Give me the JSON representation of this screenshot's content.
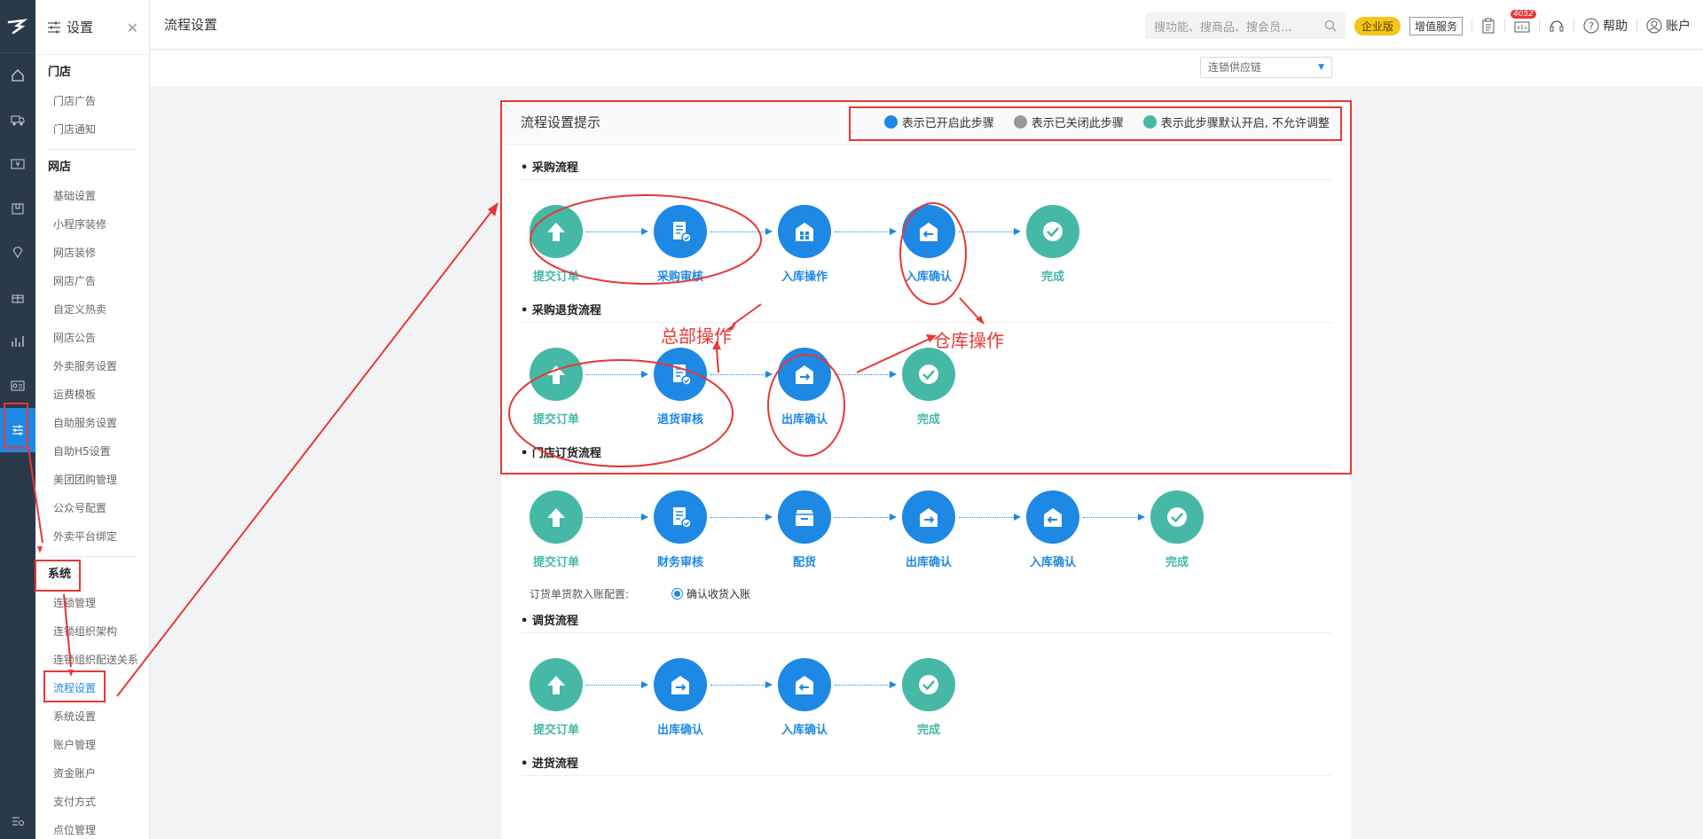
{
  "page_title": "流程设置",
  "search": {
    "placeholder": "搜功能、搜商品、搜会员..."
  },
  "topbar": {
    "badge": "企业版",
    "service": "增值服务",
    "message_count": "4052",
    "help": "帮助",
    "account": "账户"
  },
  "chain_select": {
    "value": "连锁供应链"
  },
  "menu": {
    "title": "设置",
    "groups": [
      {
        "title": "门店",
        "items": [
          "门店广告",
          "门店通知"
        ]
      },
      {
        "title": "网店",
        "items": [
          "基础设置",
          "小程序装修",
          "网店装修",
          "网店广告",
          "自定义热卖",
          "网店公告",
          "外卖服务设置",
          "运费模板",
          "自助服务设置",
          "自助H5设置",
          "美团团购管理",
          "公众号配置",
          "外卖平台绑定"
        ]
      },
      {
        "title": "系统",
        "items": [
          "连锁管理",
          "连锁组织架构",
          "连锁组织配送关系",
          "流程设置",
          "系统设置",
          "账户管理",
          "资金账户",
          "支付方式",
          "点位管理"
        ]
      }
    ],
    "active_item": "流程设置"
  },
  "tips": {
    "title": "流程设置提示",
    "legend": [
      {
        "label": "表示已开启此步骤",
        "color": "#1e88e5"
      },
      {
        "label": "表示已关闭此步骤",
        "color": "#999999"
      },
      {
        "label": "表示此步骤默认开启, 不允许调整",
        "color": "#45b8a6"
      }
    ]
  },
  "flows": [
    {
      "title": "• 采购流程",
      "steps": [
        {
          "label": "提交订单",
          "color": "teal",
          "icon": "upload-icon"
        },
        {
          "label": "采购审核",
          "color": "blue",
          "icon": "doc-check-icon"
        },
        {
          "label": "入库操作",
          "color": "blue",
          "icon": "warehouse-icon"
        },
        {
          "label": "入库确认",
          "color": "blue",
          "icon": "inbound-icon"
        },
        {
          "label": "完成",
          "color": "teal",
          "icon": "check-icon"
        }
      ]
    },
    {
      "title": "• 采购退货流程",
      "steps": [
        {
          "label": "提交订单",
          "color": "teal",
          "icon": "upload-icon"
        },
        {
          "label": "退货审核",
          "color": "blue",
          "icon": "doc-check-icon"
        },
        {
          "label": "出库确认",
          "color": "blue",
          "icon": "outbound-icon"
        },
        {
          "label": "完成",
          "color": "teal",
          "icon": "check-icon"
        }
      ]
    },
    {
      "title": "• 门店订货流程",
      "steps": [
        {
          "label": "提交订单",
          "color": "teal",
          "icon": "upload-icon"
        },
        {
          "label": "财务审核",
          "color": "blue",
          "icon": "doc-check-icon"
        },
        {
          "label": "配货",
          "color": "blue",
          "icon": "box-icon"
        },
        {
          "label": "出库确认",
          "color": "blue",
          "icon": "outbound-icon"
        },
        {
          "label": "入库确认",
          "color": "blue",
          "icon": "inbound-icon"
        },
        {
          "label": "完成",
          "color": "teal",
          "icon": "check-icon"
        }
      ],
      "config": {
        "label": "订货单货款入账配置:",
        "option": "确认收货入账"
      }
    },
    {
      "title": "• 调货流程",
      "steps": [
        {
          "label": "提交订单",
          "color": "teal",
          "icon": "upload-icon"
        },
        {
          "label": "出库确认",
          "color": "blue",
          "icon": "outbound-icon"
        },
        {
          "label": "入库确认",
          "color": "blue",
          "icon": "inbound-icon"
        },
        {
          "label": "完成",
          "color": "teal",
          "icon": "check-icon"
        }
      ]
    },
    {
      "title": "• 进货流程",
      "steps": []
    }
  ],
  "annotations": {
    "hq": "总部操作",
    "warehouse": "仓库操作"
  }
}
